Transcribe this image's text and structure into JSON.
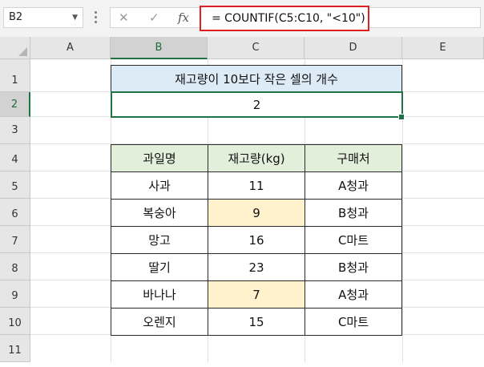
{
  "formula_bar": {
    "name_box": "B2",
    "cancel_icon": "✕",
    "enter_icon": "✓",
    "fx_icon": "fx",
    "formula": "= COUNTIF(C5:C10, \"<10\")"
  },
  "columns": [
    "A",
    "B",
    "C",
    "D",
    "E"
  ],
  "rows": [
    "1",
    "2",
    "3",
    "4",
    "5",
    "6",
    "7",
    "8",
    "9",
    "10",
    "11"
  ],
  "selected_cell": "B2",
  "title": "재고량이 10보다 작은 셀의 개수",
  "result": "2",
  "table": {
    "headers": [
      "과일명",
      "재고량(kg)",
      "구매처"
    ],
    "rows": [
      {
        "fruit": "사과",
        "stock": "11",
        "vendor": "A청과",
        "highlight": false
      },
      {
        "fruit": "복숭아",
        "stock": "9",
        "vendor": "B청과",
        "highlight": true
      },
      {
        "fruit": "망고",
        "stock": "16",
        "vendor": "C마트",
        "highlight": false
      },
      {
        "fruit": "딸기",
        "stock": "23",
        "vendor": "B청과",
        "highlight": false
      },
      {
        "fruit": "바나나",
        "stock": "7",
        "vendor": "A청과",
        "highlight": true
      },
      {
        "fruit": "오렌지",
        "stock": "15",
        "vendor": "C마트",
        "highlight": false
      }
    ]
  },
  "colors": {
    "title_fill": "#ddebf7",
    "header_fill": "#e2efda",
    "highlight_fill": "#fff2cc",
    "selection": "#217346",
    "formula_outline": "#e02020"
  }
}
